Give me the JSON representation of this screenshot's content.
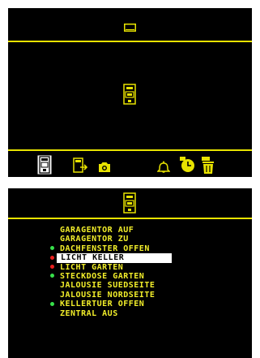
{
  "top_panel": {
    "header_icon": "screen-rectangle-icon",
    "center_icon": "remote-device-icon",
    "toolbar_icons": [
      "remote-device-icon",
      "export-arrow-icon",
      "camera-icon",
      "bell-icon",
      "clock-icon",
      "trash-icon"
    ]
  },
  "bottom_panel": {
    "header_icon": "remote-device-icon",
    "items": [
      {
        "label": "GARAGENTOR AUF",
        "status": "none"
      },
      {
        "label": "GARAGENTOR ZU",
        "status": "none"
      },
      {
        "label": "DACHFENSTER OFFEN",
        "status": "green"
      },
      {
        "label": "LICHT KELLER",
        "status": "red",
        "selected": true
      },
      {
        "label": "LICHT GARTEN",
        "status": "red"
      },
      {
        "label": "STECKDOSE GARTEN",
        "status": "green"
      },
      {
        "label": "JALOUSIE SUEDSEITE",
        "status": "none"
      },
      {
        "label": "JALOUSIE NORDSEITE",
        "status": "none"
      },
      {
        "label": "KELLERTUER OFFEN",
        "status": "green"
      },
      {
        "label": "ZENTRAL AUS",
        "status": "none"
      }
    ]
  },
  "colors": {
    "accent": "#e8e300",
    "text": "#f2ee2a",
    "status_green": "#37e04a",
    "status_red": "#e82020",
    "selection_bg": "#ffffff"
  }
}
